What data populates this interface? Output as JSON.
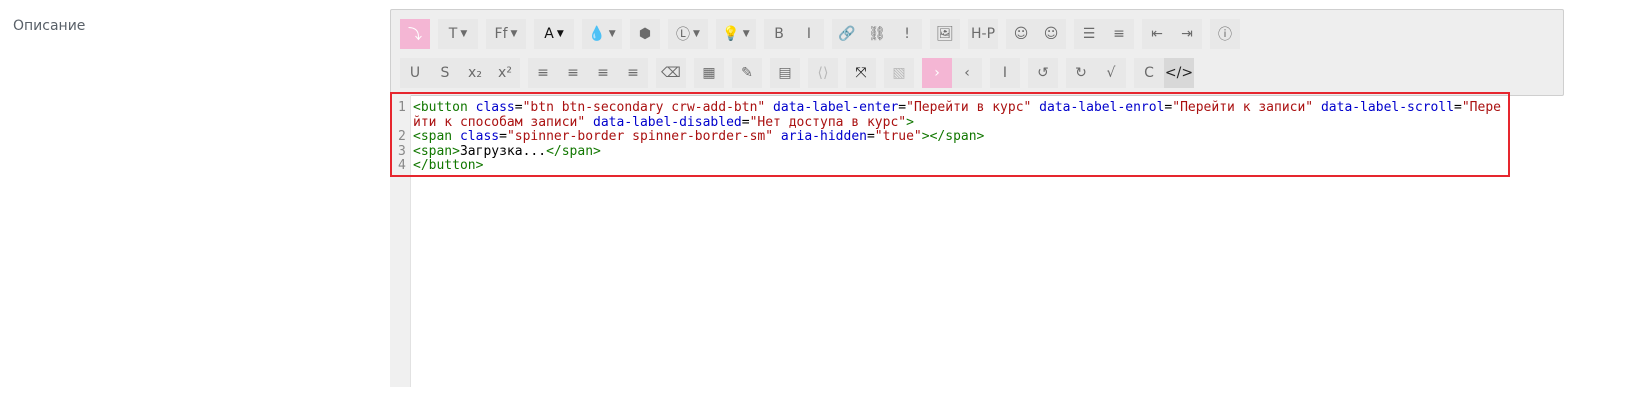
{
  "form": {
    "label": "Описание"
  },
  "toolbar": {
    "row1": [
      {
        "name": "collapse-toolbar-button",
        "glyph": "⤵",
        "style": "pink"
      },
      {
        "name": "font-size-dropdown",
        "glyph": "T",
        "caret": true
      },
      {
        "name": "font-family-dropdown",
        "glyph": "Ff",
        "caret": true
      },
      {
        "name": "font-color-dropdown",
        "glyph": "A",
        "caret": true,
        "style": "dark"
      },
      {
        "name": "background-color-dropdown",
        "glyph": "💧",
        "caret": true
      },
      {
        "name": "block-icon",
        "glyph": "⬢"
      },
      {
        "name": "style-dropdown",
        "glyph": "Ⓛ",
        "caret": true
      },
      {
        "name": "lightbulb-dropdown",
        "glyph": "💡",
        "caret": true
      },
      {
        "name": "bold-button",
        "glyph": "B"
      },
      {
        "name": "italic-button",
        "glyph": "I"
      },
      {
        "name": "link-button",
        "glyph": "🔗"
      },
      {
        "name": "unlink-button",
        "glyph": "⛓"
      },
      {
        "name": "alert-button",
        "glyph": "!"
      },
      {
        "name": "image-button",
        "glyph": "🖼"
      },
      {
        "name": "h5p-button",
        "glyph": "H-P"
      },
      {
        "name": "emoticon-button",
        "glyph": "☺"
      },
      {
        "name": "emoji-button",
        "glyph": "☺"
      },
      {
        "name": "unordered-list-button",
        "glyph": "☰"
      },
      {
        "name": "ordered-list-button",
        "glyph": "≡"
      },
      {
        "name": "outdent-button",
        "glyph": "⇤"
      },
      {
        "name": "indent-button",
        "glyph": "⇥"
      },
      {
        "name": "accessibility-button",
        "glyph": "ⓘ"
      }
    ],
    "row2": [
      {
        "name": "underline-button",
        "glyph": "U"
      },
      {
        "name": "strikethrough-button",
        "glyph": "S"
      },
      {
        "name": "subscript-button",
        "glyph": "x₂"
      },
      {
        "name": "superscript-button",
        "glyph": "x²"
      },
      {
        "name": "align-left-button",
        "glyph": "≡"
      },
      {
        "name": "align-center-button",
        "glyph": "≡"
      },
      {
        "name": "align-right-button",
        "glyph": "≡"
      },
      {
        "name": "justify-button",
        "glyph": "≡"
      },
      {
        "name": "clear-formatting-button",
        "glyph": "⌫"
      },
      {
        "name": "calculator-button",
        "glyph": "▦"
      },
      {
        "name": "edit-button",
        "glyph": "✎"
      },
      {
        "name": "table-button",
        "glyph": "▤"
      },
      {
        "name": "code-embed-button",
        "glyph": "⟨⟩",
        "style": "dim"
      },
      {
        "name": "fullscreen-button",
        "glyph": "⤧",
        "style": "dark"
      },
      {
        "name": "media-button",
        "glyph": "▧",
        "style": "dim"
      },
      {
        "name": "next-button",
        "glyph": "›",
        "style": "pink"
      },
      {
        "name": "previous-button",
        "glyph": "‹"
      },
      {
        "name": "cursor-button",
        "glyph": "I"
      },
      {
        "name": "undo-button",
        "glyph": "↺"
      },
      {
        "name": "redo-button",
        "glyph": "↻"
      },
      {
        "name": "equation-button",
        "glyph": "√"
      },
      {
        "name": "refresh-button",
        "glyph": "C"
      },
      {
        "name": "html-source-button",
        "glyph": "</>",
        "style": "active"
      },
      {
        "name": "grid-button",
        "glyph": "⠿",
        "style": "dim"
      }
    ]
  },
  "editor": {
    "line_numbers": [
      "1",
      "",
      "2",
      "3",
      "4"
    ],
    "l1_open": "<button",
    "l1_a1": " class",
    "l1_eq1": "=",
    "l1_v1": "\"btn btn-secondary crw-add-btn\"",
    "l1_a2": " data-label-enter",
    "l1_eq2": "=",
    "l1_v2": "\"Перейти в курс\"",
    "l1_a3": " data-label-enrol",
    "l1_eq3": "=",
    "l1_v3": "\"Перейти к записи\"",
    "l1_a4": " data-label-scroll",
    "l1_eq4": "=",
    "l1_v4": "\"Перейти к способам записи\"",
    "l1_a5": " data-label-disabled",
    "l1_eq5": "=",
    "l1_v5": "\"Нет доступа в курс\"",
    "l1_close": ">",
    "l2_open": "<span",
    "l2_a1": " class",
    "l2_eq1": "=",
    "l2_v1": "\"spinner-border spinner-border-sm\"",
    "l2_a2": " aria-hidden",
    "l2_eq2": "=",
    "l2_v2": "\"true\"",
    "l2_close": "></span>",
    "l3_open": "<span>",
    "l3_text": "Загрузка...",
    "l3_close": "</span>",
    "l4": "</button>"
  },
  "colors": {
    "tag": "#117700",
    "attribute": "#0000cc",
    "string": "#aa1111",
    "highlight": "#e6262e",
    "accent": "#f4b6d4"
  }
}
